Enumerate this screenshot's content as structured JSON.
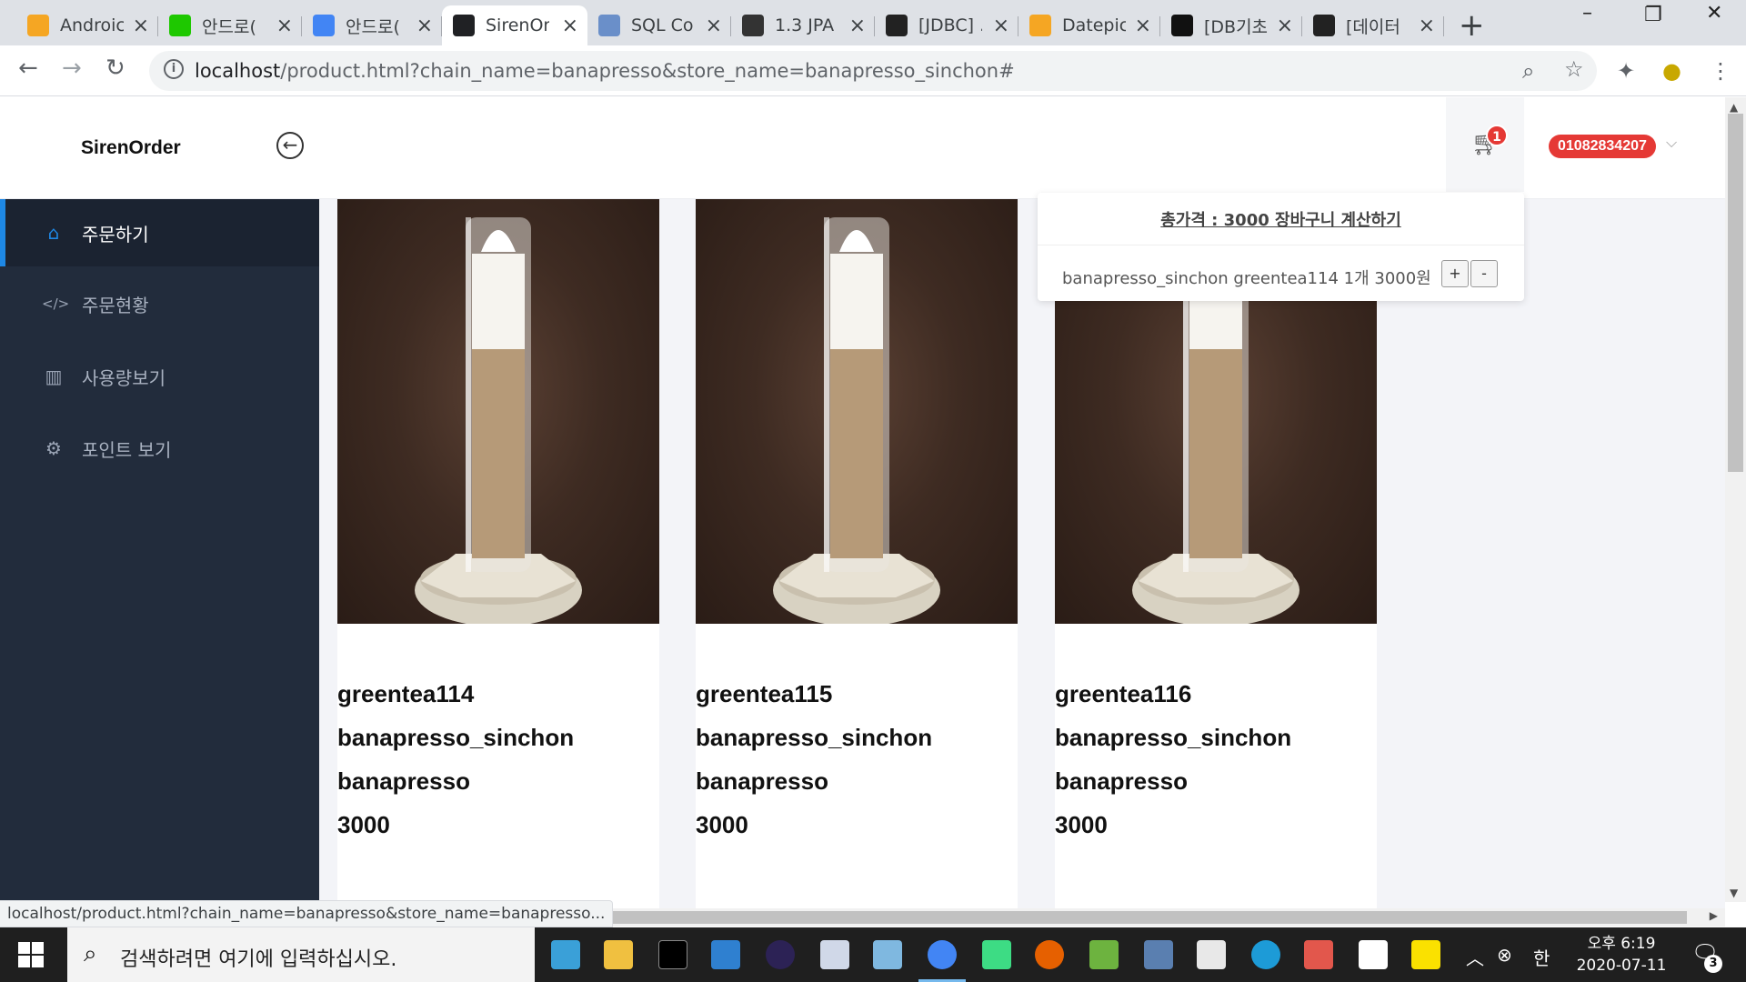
{
  "browser": {
    "tabs": [
      {
        "title": "Androic",
        "icon": "android-fire-icon",
        "color": "#f5a623"
      },
      {
        "title": "안드로(",
        "icon": "blog-icon",
        "color": "#1ec800"
      },
      {
        "title": "안드로(",
        "icon": "google-icon",
        "color": "#4285f4"
      },
      {
        "title": "SirenOr",
        "icon": "sirenorder-icon",
        "color": "#202124"
      },
      {
        "title": "SQL Co",
        "icon": "window-icon",
        "color": "#6a8fc9"
      },
      {
        "title": "1.3 JPA",
        "icon": "book-icon",
        "color": "#333333"
      },
      {
        "title": "[JDBC] .",
        "icon": "penguin-icon",
        "color": "#222222"
      },
      {
        "title": "Datepic",
        "icon": "shield-icon",
        "color": "#f5a623"
      },
      {
        "title": "[DB기초",
        "icon": "factory-icon",
        "color": "#111111"
      },
      {
        "title": "[데이터",
        "icon": "dots-icon",
        "color": "#222222"
      }
    ],
    "url_host": "localhost",
    "url_path": "/product.html?chain_name=banapresso&store_name=banapresso_sinchon#"
  },
  "header": {
    "brand": "SirenOrder",
    "cart_count": "1",
    "user_phone": "01082834207"
  },
  "sidebar": {
    "items": [
      {
        "label": "주문하기",
        "icon": "home-icon",
        "active": true
      },
      {
        "label": "주문현황",
        "icon": "code-icon",
        "active": false
      },
      {
        "label": "사용량보기",
        "icon": "bar-chart-icon",
        "active": false
      },
      {
        "label": "포인트 보기",
        "icon": "gear-icon",
        "active": false
      }
    ]
  },
  "products": [
    {
      "name": "greentea114",
      "store": "banapresso_sinchon",
      "chain": "banapresso",
      "price": "3000"
    },
    {
      "name": "greentea115",
      "store": "banapresso_sinchon",
      "chain": "banapresso",
      "price": "3000"
    },
    {
      "name": "greentea116",
      "store": "banapresso_sinchon",
      "chain": "banapresso",
      "price": "3000"
    }
  ],
  "cart": {
    "total_text": "총가격 : 3000 장바구니 계산하기",
    "line_text": "banapresso_sinchon greentea114 1개 3000원",
    "plus": "+",
    "minus": "-"
  },
  "status_bar": {
    "link_preview": "localhost/product.html?chain_name=banapresso&store_name=banapresso..."
  },
  "taskbar": {
    "search_placeholder": "검색하려면 여기에 입력하십시오.",
    "ime": "한",
    "time": "오후 6:19",
    "date": "2020-07-11",
    "notification_count": "3"
  }
}
